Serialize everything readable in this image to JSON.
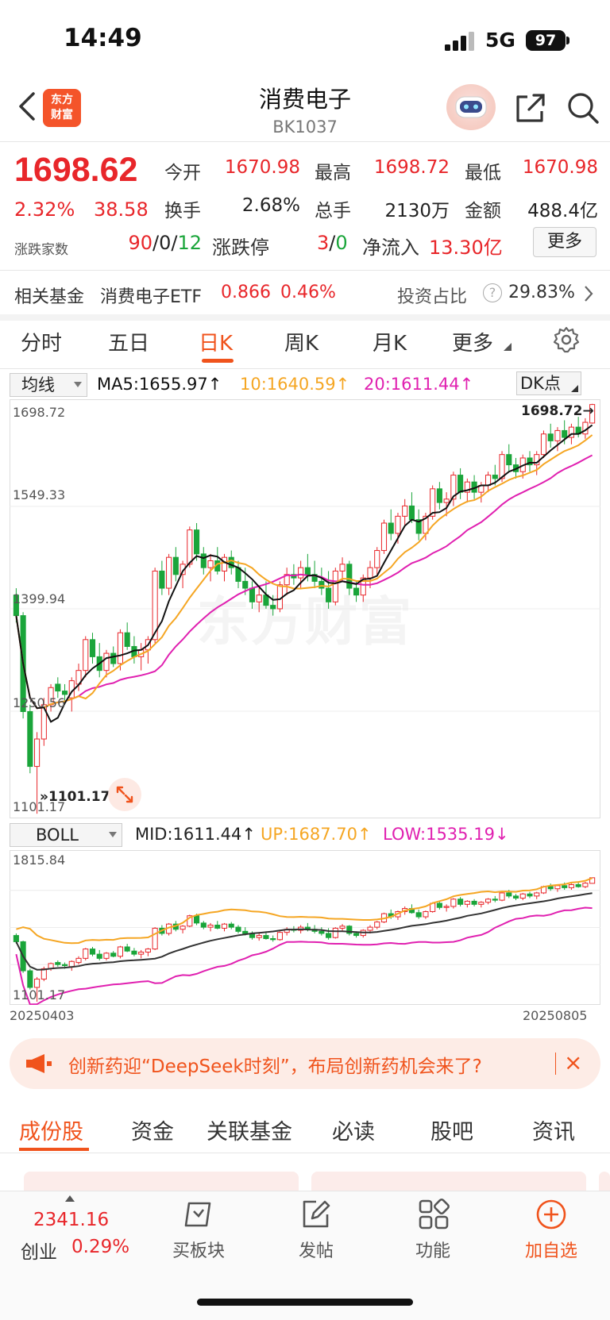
{
  "status_bar": {
    "time": "14:49",
    "network": "5G",
    "battery": "97"
  },
  "header": {
    "title": "消费电子",
    "code": "BK1037",
    "logo_line1": "东方",
    "logo_line2": "财富"
  },
  "quote": {
    "price": "1698.62",
    "change_pct": "2.32%",
    "change_amt": "38.58",
    "open_label": "今开",
    "open": "1670.98",
    "high_label": "最高",
    "high": "1698.72",
    "low_label": "最低",
    "low": "1670.98",
    "turnover_label": "换手",
    "turnover": "2.68%",
    "volume_label": "总手",
    "volume": "2130万",
    "amount_label": "金额",
    "amount": "488.4亿",
    "breadth_label": "涨跌家数",
    "breadth_up": "90",
    "breadth_flat": "0",
    "breadth_down": "12",
    "limit_label": "涨跌停",
    "limit_up": "3",
    "limit_down": "0",
    "netflow_label": "净流入",
    "netflow": "13.30亿",
    "more_label": "更多",
    "slash": "/"
  },
  "fund": {
    "label": "相关基金",
    "name": "消费电子ETF",
    "price": "0.866",
    "pct": "0.46%",
    "ratio_label": "投资占比",
    "ratio": "29.83%",
    "help": "?"
  },
  "tabs": [
    {
      "label": "分时"
    },
    {
      "label": "五日"
    },
    {
      "label": "日K"
    },
    {
      "label": "周K"
    },
    {
      "label": "月K"
    },
    {
      "label": "更多"
    }
  ],
  "ma_legend": {
    "select": "均线",
    "ma5": "MA5:1655.97",
    "ma10": "10:1640.59",
    "ma20": "20:1611.44",
    "dk": "DK点",
    "colors": {
      "ma5": "#111111",
      "ma10": "#f5a623",
      "ma20": "#e020b0",
      "up": "#e8262a",
      "down": "#1aa53a"
    }
  },
  "boll_legend": {
    "select": "BOLL",
    "mid": "MID:1611.44",
    "up": "UP:1687.70",
    "low": "LOW:1535.19",
    "colors": {
      "mid": "#333333",
      "up": "#f5a623",
      "low": "#e020b0"
    }
  },
  "chart_data": [
    {
      "type": "candlestick",
      "y_ticks": [
        "1698.72",
        "1549.33",
        "1399.94",
        "1250.56",
        "1101.17"
      ],
      "ylim": [
        1101.17,
        1698.72
      ],
      "max_marker": "1698.72",
      "min_marker": "1101.17",
      "x_start": "20250403",
      "x_end": "20250805",
      "ohlc": [
        [
          1420,
          1430,
          1380,
          1390
        ],
        [
          1390,
          1395,
          1240,
          1250
        ],
        [
          1250,
          1260,
          1160,
          1170
        ],
        [
          1170,
          1220,
          1101,
          1210
        ],
        [
          1210,
          1270,
          1200,
          1260
        ],
        [
          1260,
          1290,
          1250,
          1285
        ],
        [
          1290,
          1300,
          1270,
          1280
        ],
        [
          1280,
          1290,
          1260,
          1275
        ],
        [
          1270,
          1300,
          1250,
          1295
        ],
        [
          1290,
          1320,
          1280,
          1310
        ],
        [
          1310,
          1360,
          1300,
          1355
        ],
        [
          1355,
          1365,
          1320,
          1330
        ],
        [
          1330,
          1350,
          1300,
          1310
        ],
        [
          1310,
          1340,
          1300,
          1335
        ],
        [
          1335,
          1345,
          1315,
          1320
        ],
        [
          1320,
          1370,
          1310,
          1365
        ],
        [
          1365,
          1380,
          1340,
          1345
        ],
        [
          1345,
          1360,
          1320,
          1330
        ],
        [
          1330,
          1350,
          1310,
          1340
        ],
        [
          1340,
          1360,
          1320,
          1355
        ],
        [
          1355,
          1460,
          1350,
          1455
        ],
        [
          1455,
          1470,
          1420,
          1430
        ],
        [
          1430,
          1480,
          1420,
          1475
        ],
        [
          1475,
          1490,
          1440,
          1450
        ],
        [
          1450,
          1470,
          1430,
          1465
        ],
        [
          1465,
          1520,
          1460,
          1515
        ],
        [
          1515,
          1525,
          1470,
          1480
        ],
        [
          1480,
          1490,
          1450,
          1460
        ],
        [
          1460,
          1480,
          1440,
          1470
        ],
        [
          1470,
          1490,
          1450,
          1455
        ],
        [
          1455,
          1480,
          1440,
          1475
        ],
        [
          1475,
          1485,
          1450,
          1460
        ],
        [
          1460,
          1470,
          1430,
          1440
        ],
        [
          1440,
          1460,
          1420,
          1430
        ],
        [
          1430,
          1440,
          1400,
          1410
        ],
        [
          1410,
          1430,
          1395,
          1420
        ],
        [
          1420,
          1440,
          1400,
          1405
        ],
        [
          1405,
          1420,
          1390,
          1400
        ],
        [
          1400,
          1440,
          1395,
          1435
        ],
        [
          1435,
          1460,
          1420,
          1450
        ],
        [
          1450,
          1465,
          1435,
          1445
        ],
        [
          1445,
          1470,
          1430,
          1460
        ],
        [
          1460,
          1480,
          1440,
          1450
        ],
        [
          1450,
          1470,
          1430,
          1440
        ],
        [
          1440,
          1460,
          1420,
          1430
        ],
        [
          1430,
          1455,
          1400,
          1410
        ],
        [
          1410,
          1460,
          1405,
          1455
        ],
        [
          1455,
          1475,
          1440,
          1465
        ],
        [
          1465,
          1470,
          1420,
          1430
        ],
        [
          1430,
          1440,
          1410,
          1420
        ],
        [
          1420,
          1450,
          1410,
          1445
        ],
        [
          1445,
          1470,
          1430,
          1460
        ],
        [
          1460,
          1490,
          1450,
          1485
        ],
        [
          1485,
          1530,
          1480,
          1525
        ],
        [
          1525,
          1545,
          1500,
          1510
        ],
        [
          1510,
          1540,
          1495,
          1535
        ],
        [
          1535,
          1560,
          1520,
          1550
        ],
        [
          1550,
          1570,
          1525,
          1530
        ],
        [
          1530,
          1545,
          1500,
          1510
        ],
        [
          1510,
          1540,
          1500,
          1535
        ],
        [
          1535,
          1580,
          1530,
          1575
        ],
        [
          1575,
          1585,
          1545,
          1555
        ],
        [
          1555,
          1570,
          1535,
          1560
        ],
        [
          1560,
          1600,
          1550,
          1595
        ],
        [
          1595,
          1605,
          1560,
          1570
        ],
        [
          1570,
          1590,
          1555,
          1585
        ],
        [
          1585,
          1595,
          1560,
          1570
        ],
        [
          1570,
          1585,
          1555,
          1580
        ],
        [
          1580,
          1600,
          1570,
          1595
        ],
        [
          1595,
          1610,
          1580,
          1590
        ],
        [
          1590,
          1630,
          1585,
          1625
        ],
        [
          1625,
          1640,
          1600,
          1610
        ],
        [
          1610,
          1620,
          1590,
          1600
        ],
        [
          1600,
          1625,
          1590,
          1620
        ],
        [
          1620,
          1630,
          1600,
          1610
        ],
        [
          1610,
          1630,
          1595,
          1625
        ],
        [
          1625,
          1660,
          1620,
          1655
        ],
        [
          1655,
          1670,
          1635,
          1645
        ],
        [
          1645,
          1665,
          1630,
          1660
        ],
        [
          1660,
          1675,
          1640,
          1650
        ],
        [
          1650,
          1670,
          1640,
          1665
        ],
        [
          1665,
          1680,
          1650,
          1655
        ],
        [
          1655,
          1678,
          1648,
          1672
        ],
        [
          1671,
          1699,
          1670,
          1698
        ]
      ]
    },
    {
      "type": "line",
      "y_ticks": [
        "1815.84",
        "1101.17"
      ],
      "ylim": [
        1101.17,
        1815.84
      ]
    }
  ],
  "banner": {
    "text": "创新药迎“DeepSeek时刻”，布局创新药机会来了?",
    "close": "×"
  },
  "bottom_tabs": [
    {
      "label": "成份股"
    },
    {
      "label": "资金"
    },
    {
      "label": "关联基金"
    },
    {
      "label": "必读"
    },
    {
      "label": "股吧"
    },
    {
      "label": "资讯"
    }
  ],
  "bottom_nav": {
    "index_value": "2341.16",
    "index_name": "创业",
    "index_pct": "0.29%",
    "items": [
      {
        "label": "买板块"
      },
      {
        "label": "发帖"
      },
      {
        "label": "功能"
      },
      {
        "label": "加自选"
      }
    ]
  }
}
